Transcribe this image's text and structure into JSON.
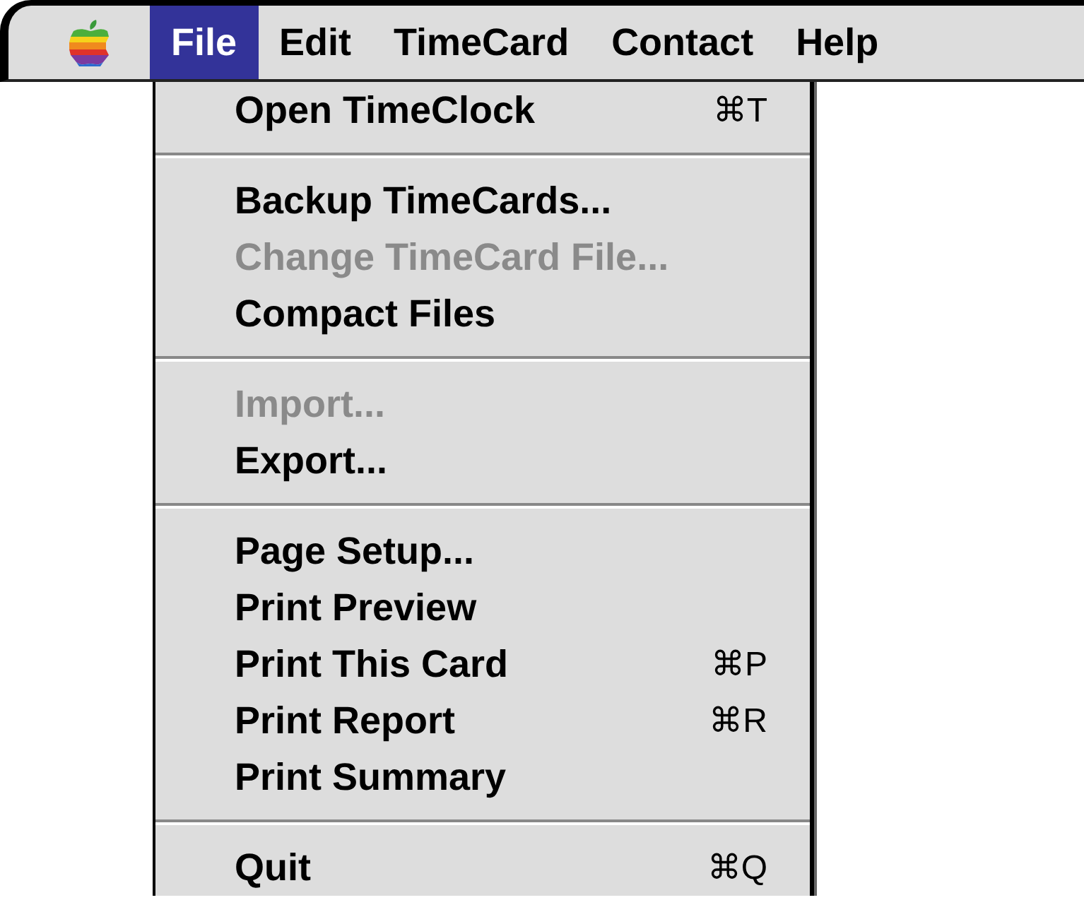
{
  "menu_bar": {
    "items": [
      {
        "label": "File",
        "selected": true
      },
      {
        "label": "Edit",
        "selected": false
      },
      {
        "label": "TimeCard",
        "selected": false
      },
      {
        "label": "Contact",
        "selected": false
      },
      {
        "label": "Help",
        "selected": false
      }
    ]
  },
  "menu": {
    "groups": [
      [
        {
          "label": "Open TimeClock",
          "shortcut": "⌘T",
          "disabled": false
        }
      ],
      [
        {
          "label": "Backup TimeCards...",
          "disabled": false
        },
        {
          "label": "Change TimeCard File...",
          "disabled": true
        },
        {
          "label": "Compact Files",
          "disabled": false
        }
      ],
      [
        {
          "label": "Import...",
          "disabled": true
        },
        {
          "label": "Export...",
          "disabled": false
        }
      ],
      [
        {
          "label": "Page Setup...",
          "disabled": false
        },
        {
          "label": "Print Preview",
          "disabled": false
        },
        {
          "label": "Print This Card",
          "shortcut": "⌘P",
          "disabled": false
        },
        {
          "label": "Print Report",
          "shortcut": "⌘R",
          "disabled": false
        },
        {
          "label": "Print Summary",
          "disabled": false
        }
      ],
      [
        {
          "label": "Quit",
          "shortcut": "⌘Q",
          "disabled": false
        }
      ]
    ]
  }
}
